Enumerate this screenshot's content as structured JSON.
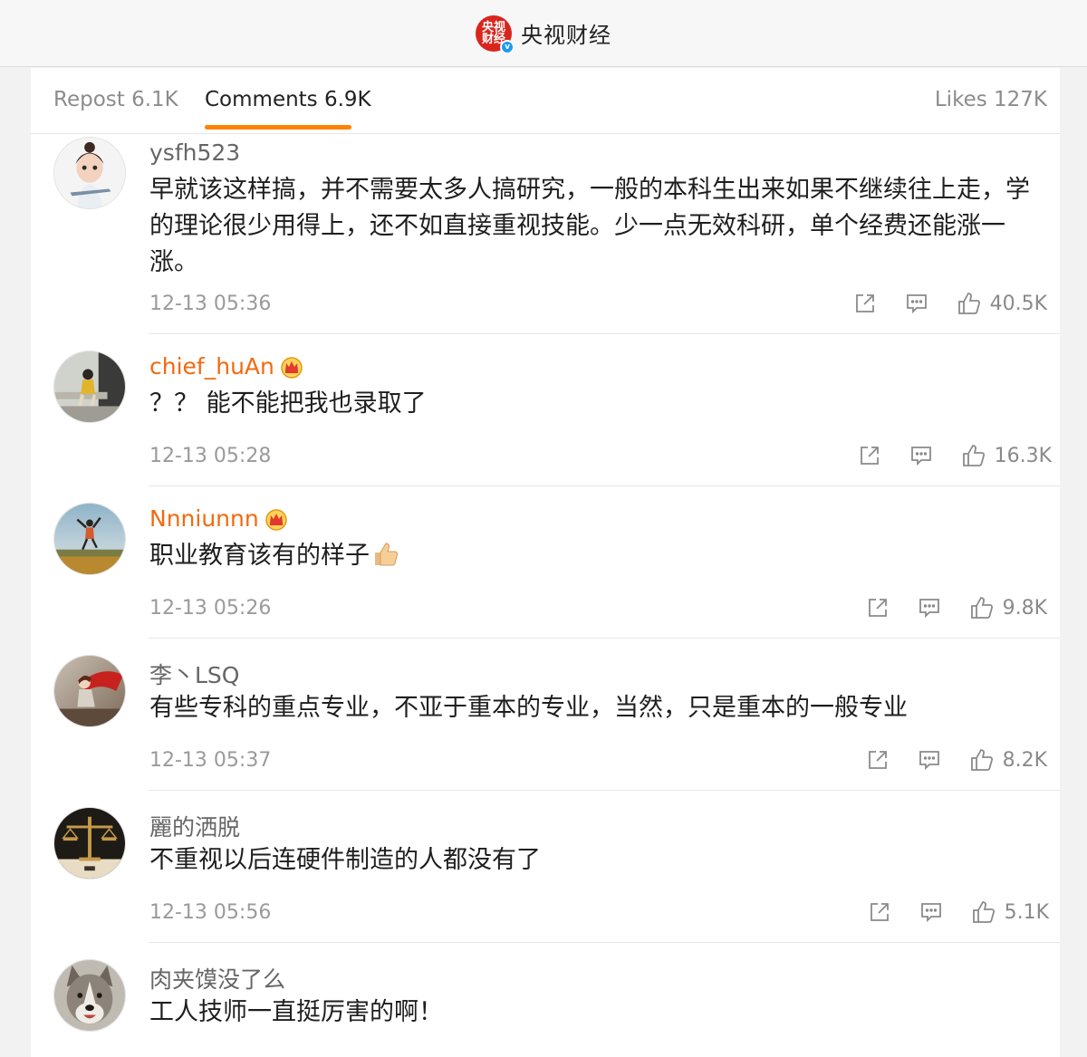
{
  "header": {
    "logo_text": "央视财经",
    "verified_mark": "v",
    "account_name": "央视财经"
  },
  "tabs": {
    "repost": "Repost 6.1K",
    "comments": "Comments 6.9K",
    "likes": "Likes 127K"
  },
  "comments": [
    {
      "user": "ysfh523",
      "vip": false,
      "text": "早就该这样搞，并不需要太多人搞研究，一般的本科生出来如果不继续往上走，学的理论很少用得上，还不如直接重视技能。少一点无效科研，单个经费还能涨一涨。",
      "time": "12-13 05:36",
      "likes": "40.5K",
      "avatar_icon": "cartoon-girl-avatar"
    },
    {
      "user": "chief_huAn",
      "vip": true,
      "text": "？？ 能不能把我也录取了",
      "time": "12-13 05:28",
      "likes": "16.3K",
      "avatar_icon": "person-sitting-avatar"
    },
    {
      "user": "Nnniunnn",
      "vip": true,
      "text": "职业教育该有的样子",
      "time": "12-13 05:26",
      "likes": "9.8K",
      "avatar_icon": "person-jumping-field-avatar"
    },
    {
      "user": "李丶LSQ",
      "vip": false,
      "text": "有些专科的重点专业，不亚于重本的专业，当然，只是重本的一般专业",
      "time": "12-13 05:37",
      "likes": "8.2K",
      "avatar_icon": "girl-red-cape-avatar"
    },
    {
      "user": "麗的洒脱",
      "vip": false,
      "text": "不重视以后连硬件制造的人都没有了",
      "time": "12-13 05:56",
      "likes": "5.1K",
      "avatar_icon": "scales-avatar"
    },
    {
      "user": "肉夹馍没了么",
      "vip": false,
      "text": "工人技师一直挺厉害的啊！",
      "avatar_icon": "dog-avatar"
    }
  ],
  "colors": {
    "accent": "#ff8200",
    "vip_name": "#f26a0f",
    "logo_red": "#d8261d",
    "verified_blue": "#1d9bf0"
  }
}
